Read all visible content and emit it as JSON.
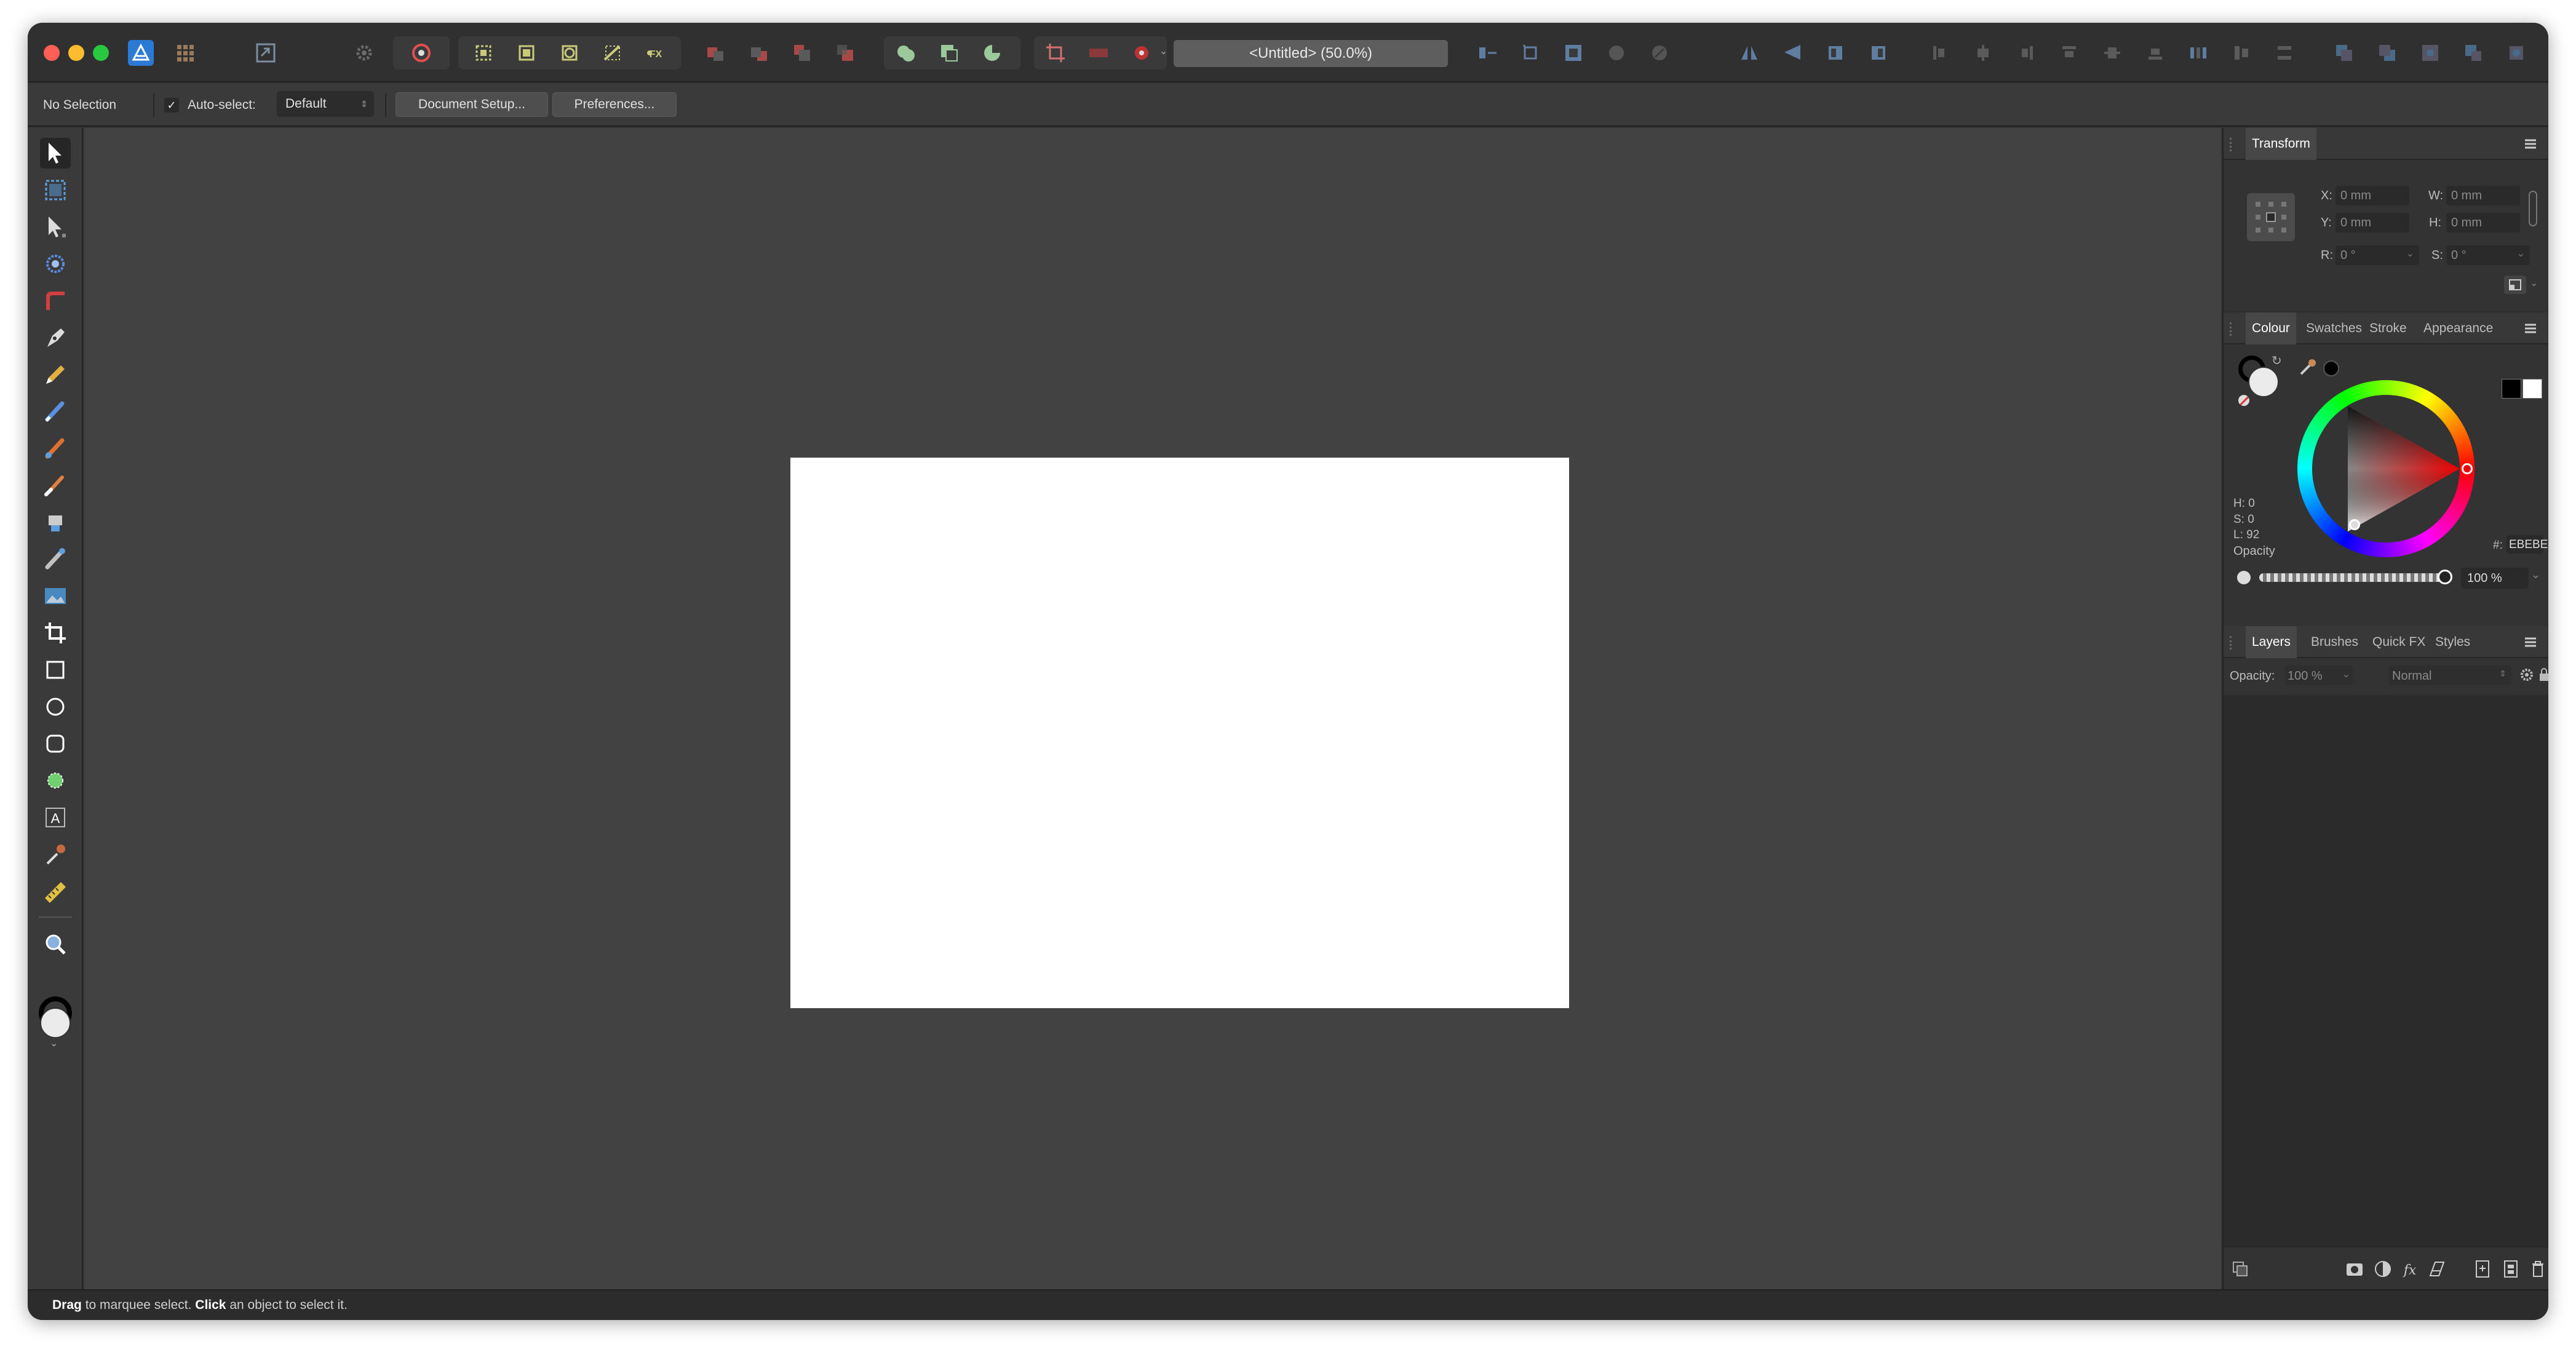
{
  "window": {
    "title": "<Untitled> (50.0%)",
    "traffic_colors": [
      "#ff5f57",
      "#febc2e",
      "#28c840"
    ]
  },
  "context": {
    "selection": "No Selection",
    "autoselect_label": "Auto-select:",
    "autoselect_mode": "Default",
    "document_setup": "Document Setup...",
    "preferences": "Preferences..."
  },
  "tools": [
    {
      "name": "move-tool-icon",
      "active": true
    },
    {
      "name": "artboard-tool-icon"
    },
    {
      "name": "node-tool-icon"
    },
    {
      "name": "contour-tool-icon"
    },
    {
      "name": "corner-tool-icon"
    },
    {
      "name": "pen-tool-icon"
    },
    {
      "name": "pencil-tool-icon"
    },
    {
      "name": "vector-brush-tool-icon"
    },
    {
      "name": "fill-tool-icon"
    },
    {
      "name": "paint-brush-tool-icon"
    },
    {
      "name": "pixel-brush-icon"
    },
    {
      "name": "erase-brush-icon"
    },
    {
      "name": "place-image-tool-icon"
    },
    {
      "name": "crop-tool-icon"
    },
    {
      "name": "rectangle-tool-icon"
    },
    {
      "name": "ellipse-tool-icon"
    },
    {
      "name": "rounded-rectangle-tool-icon"
    },
    {
      "name": "shape-tool-icon"
    },
    {
      "name": "artistic-text-tool-icon"
    },
    {
      "name": "color-picker-tool-icon"
    },
    {
      "name": "measure-tool-icon"
    },
    {
      "name": "zoom-tool-icon"
    }
  ],
  "transform": {
    "title": "Transform",
    "x_label": "X:",
    "x": "0 mm",
    "y_label": "Y:",
    "y": "0 mm",
    "w_label": "W:",
    "w": "0 mm",
    "h_label": "H:",
    "h": "0 mm",
    "r_label": "R:",
    "r": "0 °",
    "s_label": "S:",
    "s": "0 °"
  },
  "colour": {
    "tabs": [
      "Colour",
      "Swatches",
      "Stroke",
      "Appearance"
    ],
    "h": "H: 0",
    "s": "S: 0",
    "l": "L: 92",
    "hex_label": "#:",
    "hex": "EBEBEB",
    "opacity_label": "Opacity",
    "opacity": "100 %",
    "fill_color": "#ebebeb",
    "stroke_color": "#000000"
  },
  "layers": {
    "tabs": [
      "Layers",
      "Brushes",
      "Quick FX",
      "Styles"
    ],
    "opacity_label": "Opacity:",
    "opacity": "100 %",
    "blend": "Normal"
  },
  "status": {
    "b1": "Drag",
    "t1": " to marquee select. ",
    "b2": "Click",
    "t2": " an object to select it."
  }
}
